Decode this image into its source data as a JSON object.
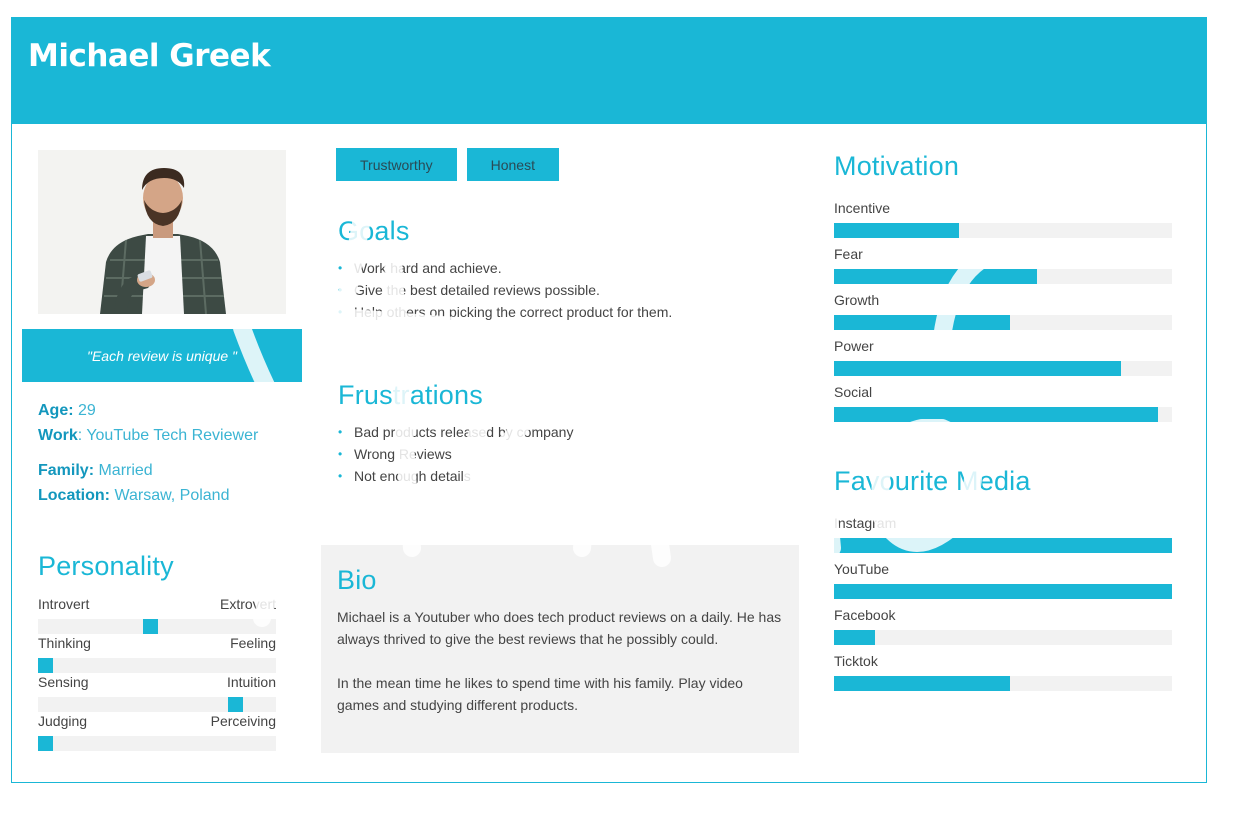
{
  "persona": {
    "name": "Michael Greek",
    "quote": "\"Each review is unique \"",
    "tags": [
      "Trustworthy",
      "Honest"
    ],
    "facts": {
      "age_label": "Age:",
      "age": "29",
      "work_label": "Work",
      "work_sep": ":",
      "work": "YouTube Tech Reviewer",
      "family_label": "Family:",
      "family": "Married",
      "location_label": "Location:",
      "location": "Warsaw, Poland"
    }
  },
  "personality": {
    "title": "Personality",
    "traits": [
      {
        "left": "Introvert",
        "right": "Extrovert",
        "position": 0.47
      },
      {
        "left": "Thinking",
        "right": "Feeling",
        "position": 0.0
      },
      {
        "left": "Sensing",
        "right": "Intuition",
        "position": 0.85
      },
      {
        "left": "Judging",
        "right": "Perceiving",
        "position": 0.0
      }
    ]
  },
  "goals": {
    "title": "Goals",
    "items": [
      "Work hard and achieve.",
      "Give the best detailed reviews possible.",
      "Help others on picking the correct product for them."
    ]
  },
  "frustrations": {
    "title": "Frustrations",
    "items": [
      "Bad products released by company",
      "Wrong Reviews",
      "Not enough details"
    ]
  },
  "bio": {
    "title": "Bio",
    "paragraphs": [
      "Michael is a Youtuber who does tech product reviews on a daily. He has always thrived to give the best reviews that he possibly could.",
      "In the mean time he likes to spend time with his family. Play video games and studying different products."
    ]
  },
  "motivation": {
    "title": "Motivation",
    "items": [
      {
        "label": "Incentive",
        "value": 0.37
      },
      {
        "label": "Fear",
        "value": 0.6
      },
      {
        "label": "Growth",
        "value": 0.52
      },
      {
        "label": "Power",
        "value": 0.85
      },
      {
        "label": "Social",
        "value": 0.96
      }
    ]
  },
  "media": {
    "title": "Favourite Media",
    "items": [
      {
        "label": "Instagram",
        "value": 1.0
      },
      {
        "label": "YouTube",
        "value": 1.0
      },
      {
        "label": "Facebook",
        "value": 0.12
      },
      {
        "label": "Ticktok",
        "value": 0.52
      }
    ]
  },
  "colors": {
    "accent": "#1ab7d6",
    "track": "#f2f2f2",
    "bio_bg": "#f2f2f2"
  }
}
